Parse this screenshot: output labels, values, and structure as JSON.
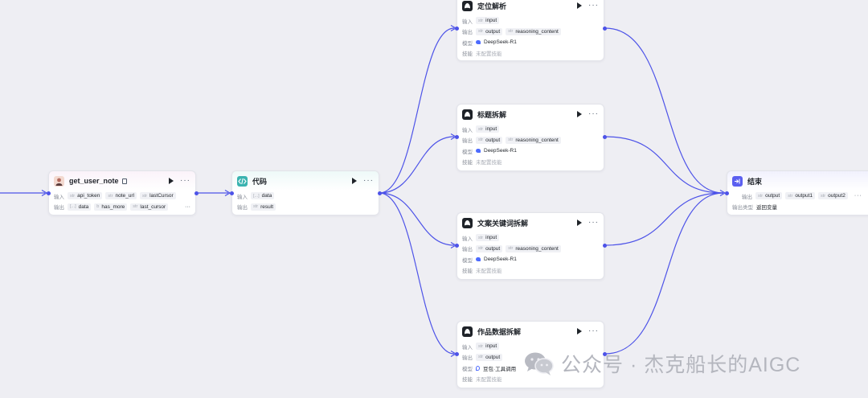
{
  "canvas": {
    "accent_color": "#4d53e8",
    "background_color": "#eeeef3"
  },
  "nodes": {
    "plugin": {
      "title": "get_user_note",
      "icon": "avatar-icon",
      "inputs_label": "输入",
      "outputs_label": "输出",
      "inputs": [
        {
          "type": "str",
          "name": "api_token"
        },
        {
          "type": "str",
          "name": "note_url"
        },
        {
          "type": "str",
          "name": "lastCursor"
        }
      ],
      "outputs": [
        {
          "type": "[...]",
          "name": "data"
        },
        {
          "type": "b",
          "name": "has_more"
        },
        {
          "type": "str",
          "name": "last_cursor"
        }
      ]
    },
    "code": {
      "title": "代码",
      "icon": "code-icon",
      "inputs_label": "输入",
      "outputs_label": "输出",
      "input": {
        "type": "[...]",
        "name": "data"
      },
      "output": {
        "type": "str",
        "name": "result"
      }
    },
    "llm": [
      {
        "title": "定位解析",
        "inputs_label": "输入",
        "outputs_label": "输出",
        "model_label": "模型",
        "skills_label": "技能",
        "input": {
          "type": "str",
          "name": "input"
        },
        "outputs": [
          {
            "type": "str",
            "name": "output"
          },
          {
            "type": "str",
            "name": "reasoning_content"
          }
        ],
        "model": "DeepSeek-R1",
        "skills": "未配置技能"
      },
      {
        "title": "标题拆解",
        "inputs_label": "输入",
        "outputs_label": "输出",
        "model_label": "模型",
        "skills_label": "技能",
        "input": {
          "type": "str",
          "name": "input"
        },
        "outputs": [
          {
            "type": "str",
            "name": "output"
          },
          {
            "type": "str",
            "name": "reasoning_content"
          }
        ],
        "model": "DeepSeek-R1",
        "skills": "未配置技能"
      },
      {
        "title": "文案关键词拆解",
        "inputs_label": "输入",
        "outputs_label": "输出",
        "model_label": "模型",
        "skills_label": "技能",
        "input": {
          "type": "str",
          "name": "input"
        },
        "outputs": [
          {
            "type": "str",
            "name": "output"
          },
          {
            "type": "str",
            "name": "reasoning_content"
          }
        ],
        "model": "DeepSeek-R1",
        "skills": "未配置技能"
      },
      {
        "title": "作品数据拆解",
        "inputs_label": "输入",
        "outputs_label": "输出",
        "model_label": "模型",
        "skills_label": "技能",
        "input": {
          "type": "str",
          "name": "input"
        },
        "outputs": [
          {
            "type": "str",
            "name": "output"
          }
        ],
        "model": "豆包·工具调用",
        "skills": "未配置技能"
      }
    ],
    "end": {
      "title": "结束",
      "outputs_label": "输出",
      "outputs": [
        {
          "type": "str",
          "name": "output"
        },
        {
          "type": "str",
          "name": "output1"
        },
        {
          "type": "str",
          "name": "output2"
        }
      ],
      "output_type_label": "输出类型",
      "output_type": "返回变量"
    }
  },
  "watermark": {
    "text": "公众号 · 杰克船长的AIGC",
    "icon": "wechat-icon"
  }
}
